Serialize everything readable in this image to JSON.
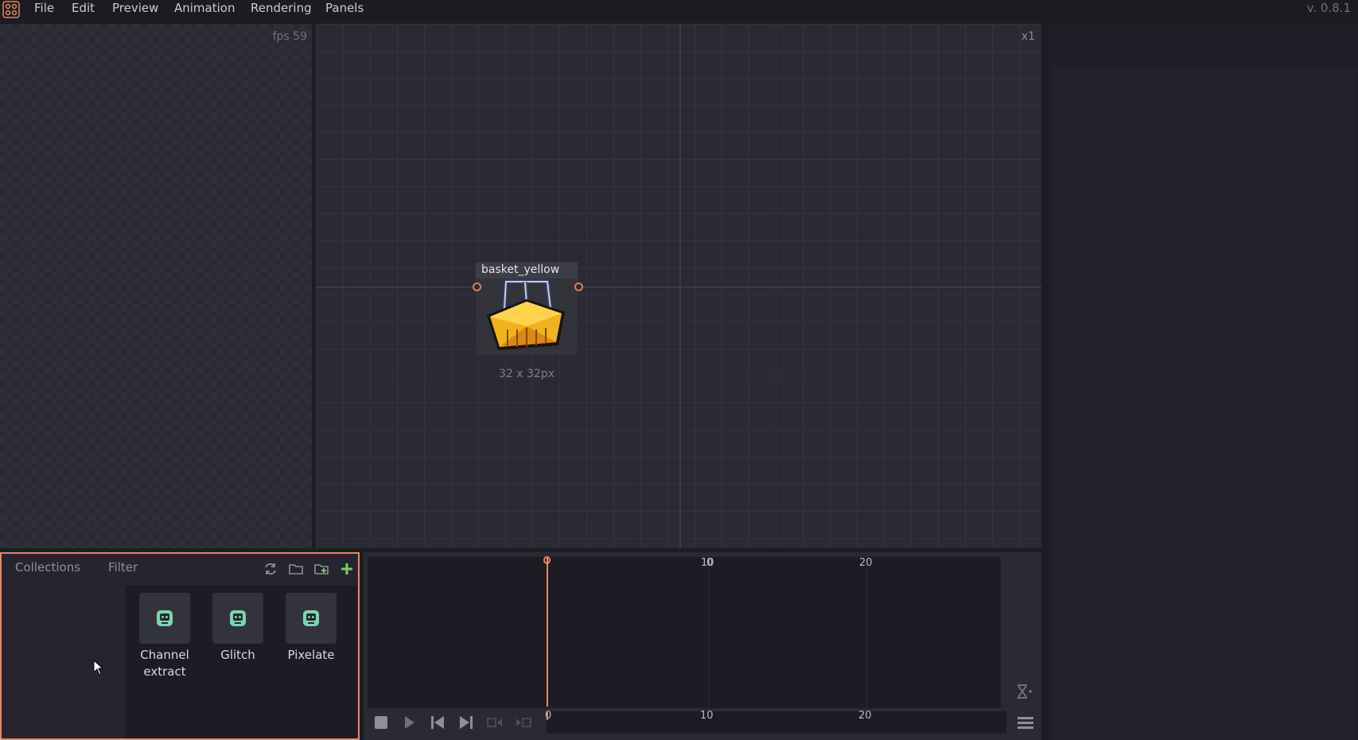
{
  "menubar": {
    "items": [
      "File",
      "Edit",
      "Preview",
      "Animation",
      "Rendering",
      "Panels"
    ],
    "version": "v. 0.8.1"
  },
  "preview": {
    "fps_label": "fps 59"
  },
  "graph": {
    "zoom_label": "x1",
    "node": {
      "title": "basket_yellow",
      "size_label": "32 x 32px"
    }
  },
  "collections": {
    "tabs": [
      "Collections",
      "Filter"
    ],
    "items": [
      {
        "label_line1": "Channel",
        "label_line2": "extract"
      },
      {
        "label_line1": "Glitch",
        "label_line2": ""
      },
      {
        "label_line1": "Pixelate",
        "label_line2": ""
      }
    ]
  },
  "timeline": {
    "ticks": [
      "0",
      "10",
      "20"
    ],
    "mini_ticks": [
      "0",
      "10",
      "20"
    ]
  },
  "colors": {
    "accent": "#e8875f",
    "background": "#1c1c25",
    "panel": "#2a2a33"
  }
}
